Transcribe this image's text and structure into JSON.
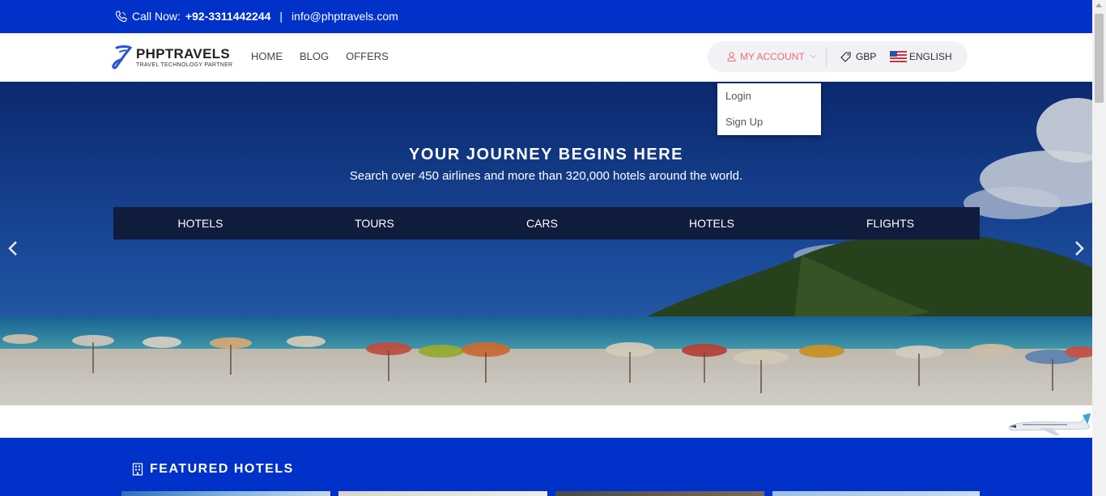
{
  "topbar": {
    "call_label": "Call Now:",
    "phone": "+92-3311442244",
    "separator": "|",
    "email": "info@phptravels.com"
  },
  "header": {
    "logo_name": "PHPTRAVELS",
    "logo_tagline": "TRAVEL TECHNOLOGY PARTNER",
    "nav": [
      "HOME",
      "BLOG",
      "OFFERS"
    ],
    "account_label": "MY ACCOUNT",
    "currency": "GBP",
    "language": "ENGLISH"
  },
  "account_dropdown": {
    "items": [
      "Login",
      "Sign Up"
    ]
  },
  "hero": {
    "title": "YOUR JOURNEY BEGINS HERE",
    "subtitle": "Search over 450 airlines and more than 320,000 hotels around the world.",
    "tabs": [
      "HOTELS",
      "TOURS",
      "CARS",
      "HOTELS",
      "FLIGHTS"
    ]
  },
  "featured": {
    "title": "FEATURED HOTELS"
  },
  "colors": {
    "brand_blue": "#0031c8",
    "account_accent": "#f26b6b",
    "tab_bar": "#101c3c"
  }
}
